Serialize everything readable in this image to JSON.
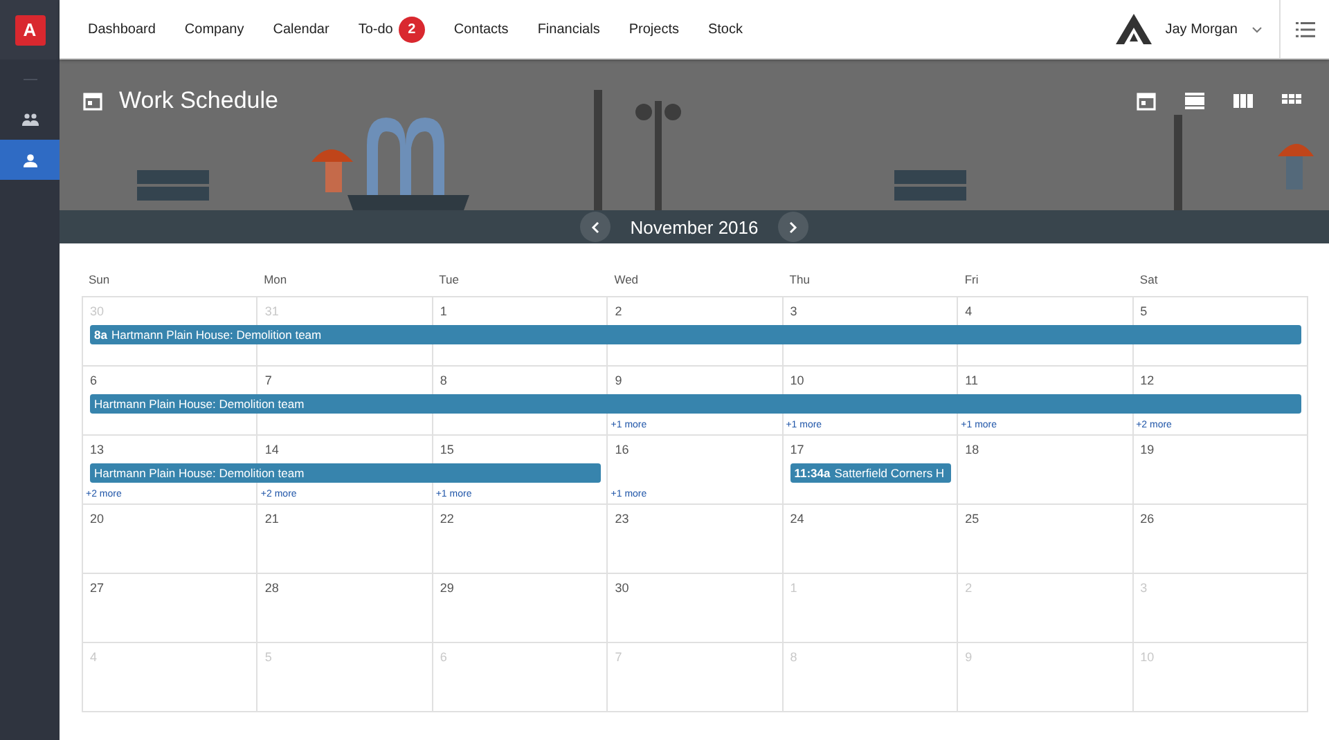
{
  "app_logo": "A",
  "sidebar": {
    "items": [
      {
        "kind": "group",
        "selected": false
      },
      {
        "kind": "person",
        "selected": true
      }
    ]
  },
  "nav": {
    "items": [
      {
        "label": "Dashboard"
      },
      {
        "label": "Company"
      },
      {
        "label": "Calendar"
      },
      {
        "label": "To-do",
        "badge": "2"
      },
      {
        "label": "Contacts"
      },
      {
        "label": "Financials"
      },
      {
        "label": "Projects"
      },
      {
        "label": "Stock"
      }
    ]
  },
  "user": {
    "name": "Jay Morgan"
  },
  "banner": {
    "title": "Work Schedule",
    "month": "November 2016",
    "views": [
      {
        "kind": "day"
      },
      {
        "kind": "list"
      },
      {
        "kind": "week"
      },
      {
        "kind": "month"
      }
    ]
  },
  "calendar": {
    "weekdays": [
      "Sun",
      "Mon",
      "Tue",
      "Wed",
      "Thu",
      "Fri",
      "Sat"
    ],
    "weeks": [
      {
        "days": [
          {
            "date": "30",
            "muted": true,
            "event": {
              "time": "8a",
              "title": "Hartmann Plain House: Demolition team"
            }
          },
          {
            "date": "31",
            "muted": true,
            "covered": true
          },
          {
            "date": "1",
            "muted": false,
            "covered": true
          },
          {
            "date": "2",
            "muted": false,
            "covered": true
          },
          {
            "date": "3",
            "muted": false,
            "covered": true
          },
          {
            "date": "4",
            "muted": false,
            "covered": true
          },
          {
            "date": "5",
            "muted": false,
            "covered": true
          }
        ]
      },
      {
        "days": [
          {
            "date": "6",
            "muted": false,
            "event": {
              "title": "Hartmann Plain House: Demolition team"
            }
          },
          {
            "date": "7",
            "muted": false,
            "covered": true
          },
          {
            "date": "8",
            "muted": false,
            "covered": true
          },
          {
            "date": "9",
            "muted": false,
            "covered": true,
            "more": "+1 more"
          },
          {
            "date": "10",
            "muted": false,
            "covered": true,
            "more": "+1 more"
          },
          {
            "date": "11",
            "muted": false,
            "covered": true,
            "more": "+1 more"
          },
          {
            "date": "12",
            "muted": false,
            "covered": true,
            "more": "+2 more"
          }
        ]
      },
      {
        "days": [
          {
            "date": "13",
            "muted": false,
            "more": "+2 more",
            "event": {
              "title": "Hartmann Plain House: Demolition team"
            }
          },
          {
            "date": "14",
            "muted": false,
            "covered": true,
            "more": "+2 more"
          },
          {
            "date": "15",
            "muted": false,
            "covered": true,
            "more": "+1 more"
          },
          {
            "date": "16",
            "muted": false,
            "more": "+1 more"
          },
          {
            "date": "17",
            "muted": false,
            "event": {
              "time": "11:34a",
              "title": "Satterfield Corners H"
            }
          },
          {
            "date": "18",
            "muted": false
          },
          {
            "date": "19",
            "muted": false
          }
        ]
      },
      {
        "days": [
          {
            "date": "20",
            "muted": false
          },
          {
            "date": "21",
            "muted": false
          },
          {
            "date": "22",
            "muted": false
          },
          {
            "date": "23",
            "muted": false
          },
          {
            "date": "24",
            "muted": false
          },
          {
            "date": "25",
            "muted": false
          },
          {
            "date": "26",
            "muted": false
          }
        ]
      },
      {
        "days": [
          {
            "date": "27",
            "muted": false
          },
          {
            "date": "28",
            "muted": false
          },
          {
            "date": "29",
            "muted": false
          },
          {
            "date": "30",
            "muted": false
          },
          {
            "date": "1",
            "muted": true
          },
          {
            "date": "2",
            "muted": true
          },
          {
            "date": "3",
            "muted": true
          }
        ]
      },
      {
        "days": [
          {
            "date": "4",
            "muted": true
          },
          {
            "date": "5",
            "muted": true
          },
          {
            "date": "6",
            "muted": true
          },
          {
            "date": "7",
            "muted": true
          },
          {
            "date": "8",
            "muted": true
          },
          {
            "date": "9",
            "muted": true
          },
          {
            "date": "10",
            "muted": true
          }
        ]
      }
    ]
  }
}
